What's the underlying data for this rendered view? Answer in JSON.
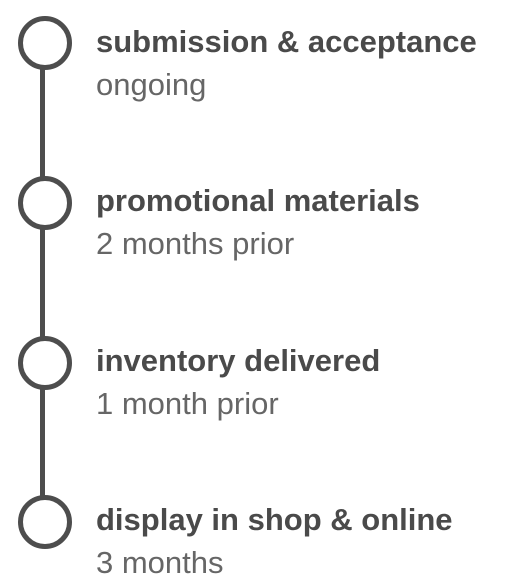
{
  "timeline": {
    "steps": [
      {
        "title": "submission & acceptance",
        "timing": "ongoing"
      },
      {
        "title": "promotional materials",
        "timing": "2 months prior"
      },
      {
        "title": "inventory delivered",
        "timing": "1 month prior"
      },
      {
        "title": "display in shop & online",
        "timing": "3 months"
      }
    ]
  },
  "colors": {
    "line": "#4d4d4d",
    "title_text": "#4a4a4a",
    "timing_text": "#666666",
    "background": "#ffffff"
  }
}
